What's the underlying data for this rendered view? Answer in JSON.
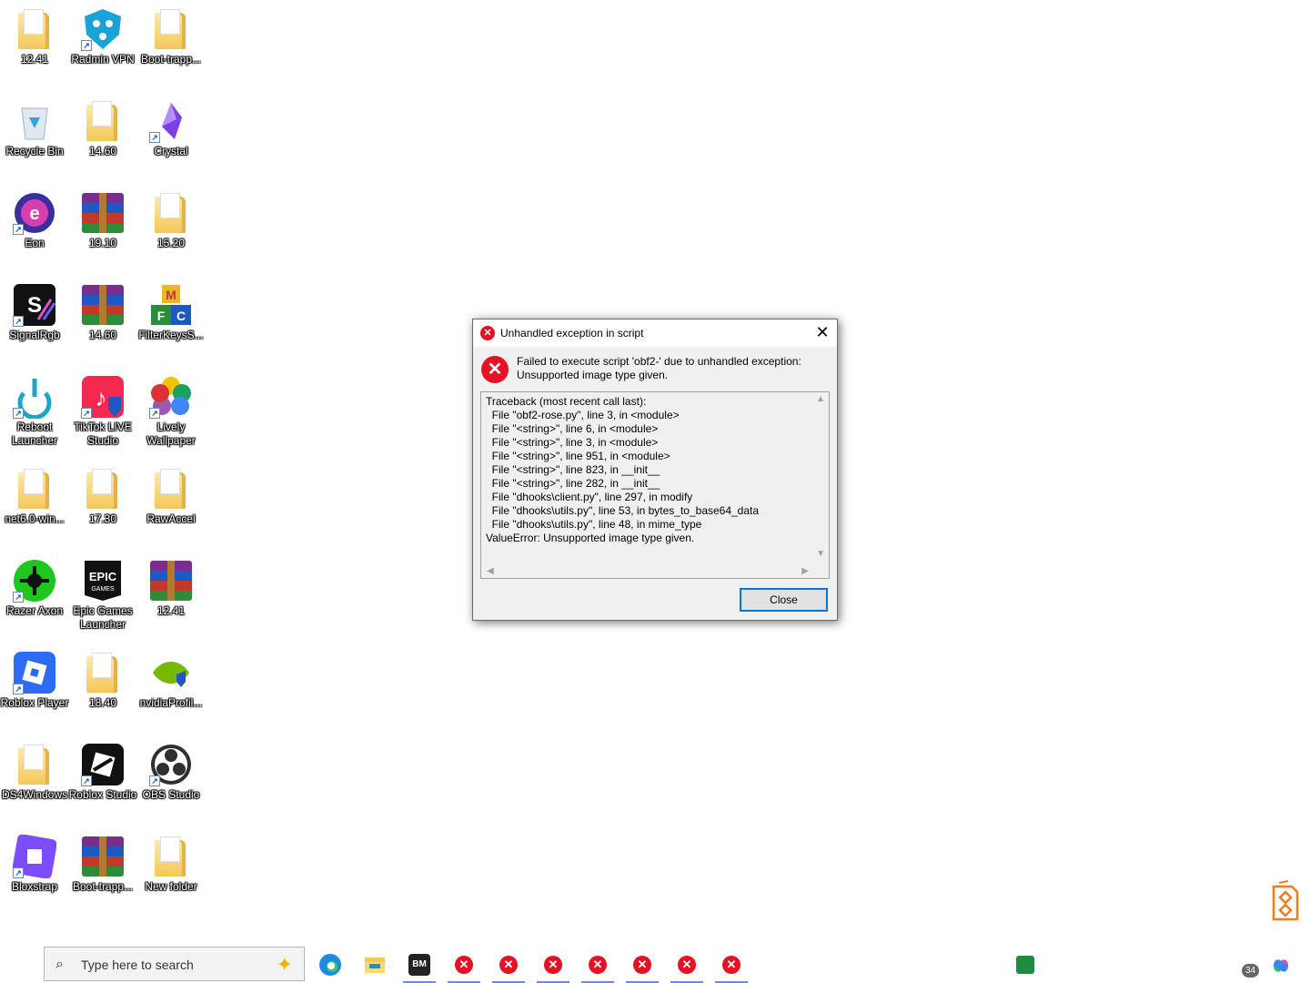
{
  "desktop": {
    "icons": [
      {
        "label": "12.41",
        "icon": "folder-icon"
      },
      {
        "label": "Radmin VPN",
        "icon": "radmin-vpn-icon"
      },
      {
        "label": "Boot-trapp...",
        "icon": "folder-icon"
      },
      {
        "label": "Recycle Bin",
        "icon": "recycle-bin-icon"
      },
      {
        "label": "14.60",
        "icon": "folder-icon"
      },
      {
        "label": "Crystal",
        "icon": "crystal-icon"
      },
      {
        "label": "Eon",
        "icon": "eon-icon"
      },
      {
        "label": "19.10",
        "icon": "winrar-icon"
      },
      {
        "label": "15.20",
        "icon": "folder-icon"
      },
      {
        "label": "SignalRgb",
        "icon": "signalrgb-icon"
      },
      {
        "label": "14.60",
        "icon": "winrar-icon"
      },
      {
        "label": "FilterKeysS...",
        "icon": "filterkeys-icon"
      },
      {
        "label": "Reboot Launcher",
        "icon": "reboot-launcher-icon"
      },
      {
        "label": "TikTok LIVE Studio",
        "icon": "tiktok-icon"
      },
      {
        "label": "Lively Wallpaper",
        "icon": "lively-wallpaper-icon"
      },
      {
        "label": "net6.0-win...",
        "icon": "folder-icon"
      },
      {
        "label": "17.30",
        "icon": "folder-icon"
      },
      {
        "label": "RawAccel",
        "icon": "folder-icon"
      },
      {
        "label": "Razer Axon",
        "icon": "razer-axon-icon"
      },
      {
        "label": "Epic Games Launcher",
        "icon": "epic-games-icon"
      },
      {
        "label": "12.41",
        "icon": "winrar-icon"
      },
      {
        "label": "Roblox Player",
        "icon": "roblox-player-icon"
      },
      {
        "label": "18.40",
        "icon": "folder-icon"
      },
      {
        "label": "nvidiaProfil...",
        "icon": "nvidia-icon"
      },
      {
        "label": "DS4Windows",
        "icon": "folder-icon"
      },
      {
        "label": "Roblox Studio",
        "icon": "roblox-studio-icon"
      },
      {
        "label": "OBS Studio",
        "icon": "obs-icon"
      },
      {
        "label": "Bloxstrap",
        "icon": "bloxstrap-icon"
      },
      {
        "label": "Boot-trapp...",
        "icon": "winrar-icon"
      },
      {
        "label": "New folder",
        "icon": "folder-icon"
      }
    ]
  },
  "dialog": {
    "title": "Unhandled exception in script",
    "message_line1": "Failed to execute script 'obf2-' due to unhandled exception:",
    "message_line2": "Unsupported image type given.",
    "traceback": "Traceback (most recent call last):\n  File \"obf2-rose.py\", line 3, in <module>\n  File \"<string>\", line 6, in <module>\n  File \"<string>\", line 3, in <module>\n  File \"<string>\", line 951, in <module>\n  File \"<string>\", line 823, in __init__\n  File \"<string>\", line 282, in __init__\n  File \"dhooks\\client.py\", line 297, in modify\n  File \"dhooks\\utils.py\", line 53, in bytes_to_base64_data\n  File \"dhooks\\utils.py\", line 48, in mime_type\nValueError: Unsupported image type given.",
    "close_button": "Close",
    "close_x": "✕"
  },
  "taskbar": {
    "search_placeholder": "Type here to search",
    "error_windows": 7,
    "tray_badge": "34"
  }
}
